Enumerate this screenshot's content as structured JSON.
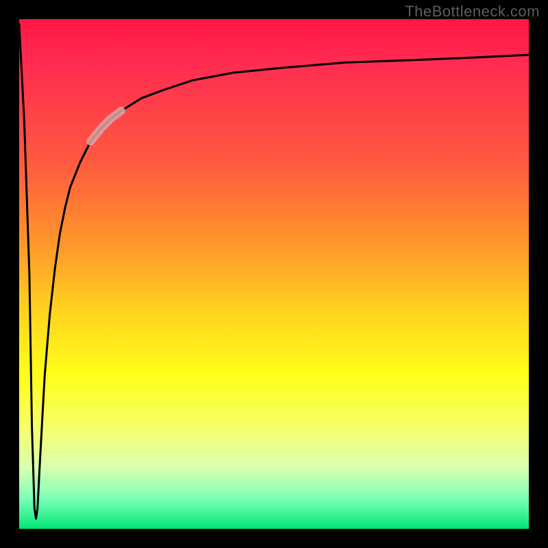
{
  "watermark": "TheBottleneck.com",
  "chart_data": {
    "type": "line",
    "title": "",
    "xlabel": "",
    "ylabel": "",
    "xlim": [
      0,
      100
    ],
    "ylim": [
      0,
      100
    ],
    "grid": false,
    "legend": false,
    "annotations": [],
    "gradient_stops": [
      {
        "pos": 0,
        "color": "#ff1744"
      },
      {
        "pos": 8,
        "color": "#ff2a52"
      },
      {
        "pos": 28,
        "color": "#ff5a3f"
      },
      {
        "pos": 45,
        "color": "#ff9a2a"
      },
      {
        "pos": 58,
        "color": "#ffd61e"
      },
      {
        "pos": 70,
        "color": "#ffff1a"
      },
      {
        "pos": 80,
        "color": "#f6ff6a"
      },
      {
        "pos": 88,
        "color": "#d9ffb0"
      },
      {
        "pos": 94,
        "color": "#7dffb8"
      },
      {
        "pos": 100,
        "color": "#00e676"
      }
    ],
    "series": [
      {
        "name": "bottleneck-curve",
        "color": "#000000",
        "x": [
          0,
          1,
          2,
          2.5,
          3,
          3.3,
          3.6,
          4,
          5,
          6,
          7,
          8,
          9,
          10,
          12,
          14,
          16,
          18,
          20,
          24,
          28,
          34,
          42,
          52,
          64,
          78,
          90,
          100
        ],
        "y": [
          99,
          80,
          50,
          20,
          4,
          2,
          4,
          12,
          30,
          42,
          51,
          58,
          63,
          67,
          72,
          76,
          78.5,
          80.5,
          82,
          84.5,
          86,
          88,
          89.5,
          90.5,
          91.5,
          92,
          92.5,
          93
        ]
      },
      {
        "name": "highlight-segment",
        "color": "#d9a6a6",
        "x": [
          14,
          16,
          18,
          20
        ],
        "y": [
          76,
          78.5,
          80.5,
          82
        ]
      }
    ]
  }
}
